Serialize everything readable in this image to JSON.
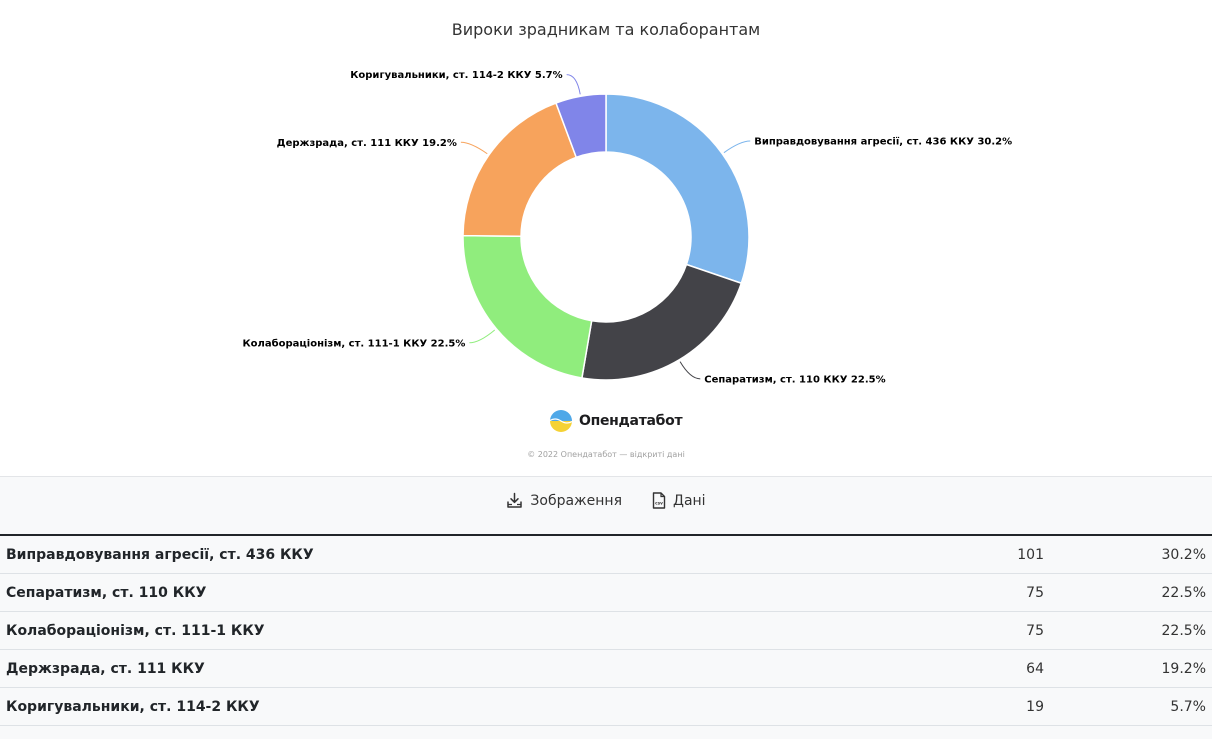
{
  "chart_data": {
    "type": "pie",
    "title": "Вироки зрадникам та колаборантам",
    "categories": [
      "Виправдовування агресії, ст. 436 ККУ",
      "Сепаратизм, ст. 110 ККУ",
      "Колабораціонізм, ст. 111-1 ККУ",
      "Держзрада, ст. 111 ККУ",
      "Коригувальники, ст. 114-2 ККУ"
    ],
    "values": [
      101,
      75,
      75,
      64,
      19
    ],
    "percents": [
      "30.2%",
      "22.5%",
      "22.5%",
      "19.2%",
      "5.7%"
    ],
    "colors": [
      "#7cb5ec",
      "#434348",
      "#90ed7d",
      "#f7a35c",
      "#8085e9"
    ],
    "labels": [
      "Виправдовування агресії, ст. 436 ККУ 30.2%",
      "Сепаратизм, ст. 110 ККУ 22.5%",
      "Колабораціонізм, ст. 111-1 ККУ 22.5%",
      "Держзрада, ст. 111 ККУ 19.2%",
      "Коригувальники, ст. 114-2 ККУ 5.7%"
    ],
    "donut": true
  },
  "brand": {
    "name": "Опендатабот"
  },
  "copyright": "© 2022 Опендатабот — відкриті дані",
  "actions": {
    "image_label": "Зображення",
    "data_label": "Дані",
    "csv_icon_text": "csv"
  },
  "table": {
    "rows": [
      {
        "name": "Виправдовування агресії, ст. 436 ККУ",
        "count": "101",
        "pct": "30.2%"
      },
      {
        "name": "Сепаратизм, ст. 110 ККУ",
        "count": "75",
        "pct": "22.5%"
      },
      {
        "name": "Колабораціонізм, ст. 111-1 ККУ",
        "count": "75",
        "pct": "22.5%"
      },
      {
        "name": "Держзрада, ст. 111 ККУ",
        "count": "64",
        "pct": "19.2%"
      },
      {
        "name": "Коригувальники, ст. 114-2 ККУ",
        "count": "19",
        "pct": "5.7%"
      }
    ]
  }
}
